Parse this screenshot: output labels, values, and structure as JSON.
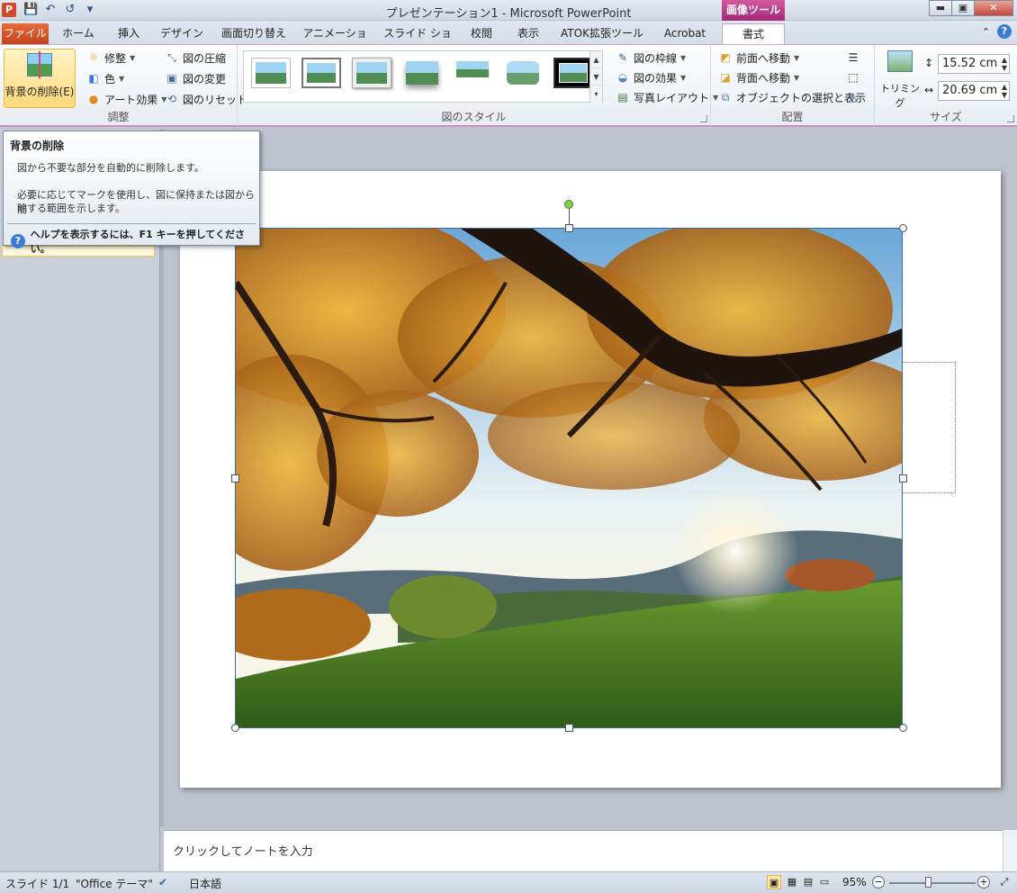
{
  "window": {
    "title": "プレゼンテーション1 - Microsoft PowerPoint",
    "app_icon": "P",
    "contextual_header": "画像ツール",
    "minimize": "▬",
    "maximize": "▣",
    "close": "✕"
  },
  "qat": {
    "save_icon": "💾",
    "undo_icon": "↶",
    "redo_icon": "↺",
    "customize_icon": "▾"
  },
  "tabs": {
    "file": "ファイル",
    "home": "ホーム",
    "insert": "挿入",
    "design": "デザイン",
    "transitions": "画面切り替え",
    "animations": "アニメーション",
    "slideshow": "スライド ショー",
    "review": "校閲",
    "view": "表示",
    "atok": "ATOK拡張ツール",
    "acrobat": "Acrobat",
    "format": "書式"
  },
  "ribbon": {
    "adjust": {
      "label": "調整",
      "remove_bg": "背景の削除(E)",
      "corrections": "修整",
      "color": "色",
      "artistic": "アート効果",
      "compress": "図の圧縮",
      "change": "図の変更",
      "reset": "図のリセット"
    },
    "styles": {
      "label": "図のスタイル",
      "border": "図の枠線",
      "effects": "図の効果",
      "layout": "写真レイアウト"
    },
    "arrange": {
      "label": "配置",
      "bring_forward": "前面へ移動",
      "send_backward": "背面へ移動",
      "selection_pane": "オブジェクトの選択と表示"
    },
    "size": {
      "label": "サイズ",
      "crop": "トリミング",
      "height": "15.52 cm",
      "width": "20.69 cm"
    }
  },
  "tooltip": {
    "title": "背景の削除",
    "line1": "図から不要な部分を自動的に削除します。",
    "line2": "必要に応じてマークを使用し、図に保持または図から削",
    "line3": "除する範囲を示します。",
    "help": "ヘルプを表示するには、F1 キーを押してください。"
  },
  "notes": {
    "placeholder": "クリックしてノートを入力"
  },
  "status": {
    "slide": "スライド 1/1",
    "theme": "\"Office テーマ\"",
    "language": "日本語",
    "zoom": "95%"
  },
  "colors": {
    "accent_context": "#a32678",
    "file_tab": "#c4421a"
  }
}
